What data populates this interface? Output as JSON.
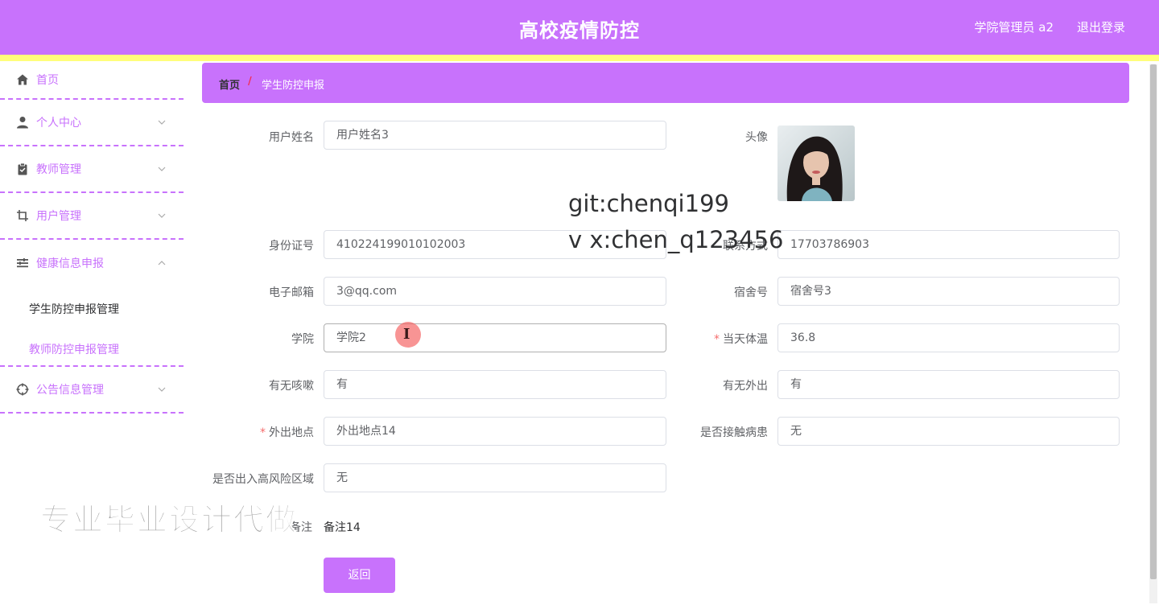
{
  "header": {
    "title": "高校疫情防控",
    "user": "学院管理员 a2",
    "logout": "退出登录"
  },
  "sidebar": {
    "items": [
      {
        "label": "首页",
        "icon": "home-icon"
      },
      {
        "label": "个人中心",
        "icon": "user-icon"
      },
      {
        "label": "教师管理",
        "icon": "clipboard-icon"
      },
      {
        "label": "用户管理",
        "icon": "crop-icon"
      },
      {
        "label": "健康信息申报",
        "icon": "list-icon"
      },
      {
        "label": "公告信息管理",
        "icon": "target-icon"
      }
    ],
    "submenu": [
      "学生防控申报管理",
      "教师防控申报管理"
    ]
  },
  "breadcrumb": {
    "home": "首页",
    "separator": "/",
    "current": "学生防控申报"
  },
  "form": {
    "username": {
      "label": "用户姓名",
      "value": "用户姓名3"
    },
    "avatar": {
      "label": "头像"
    },
    "idcard": {
      "label": "身份证号",
      "value": "410224199010102003"
    },
    "phone": {
      "label": "联系方式",
      "value": "17703786903"
    },
    "email": {
      "label": "电子邮箱",
      "value": "3@qq.com"
    },
    "dorm": {
      "label": "宿舍号",
      "value": "宿舍号3"
    },
    "college": {
      "label": "学院",
      "value": "学院2"
    },
    "temperature": {
      "label": "当天体温",
      "value": "36.8"
    },
    "cough": {
      "label": "有无咳嗽",
      "value": "有"
    },
    "goout": {
      "label": "有无外出",
      "value": "有"
    },
    "place": {
      "label": "外出地点",
      "value": "外出地点14"
    },
    "contact": {
      "label": "是否接触病患",
      "value": "无"
    },
    "risk": {
      "label": "是否出入高风险区域",
      "value": "无"
    },
    "remark": {
      "label": "备注",
      "value": "备注14"
    },
    "back": "返回"
  },
  "overlays": {
    "watermark_line1": "git:chenqi199",
    "watermark_line2": "v x:chen_q123456",
    "promo": "专业毕业设计代做",
    "cursor": "I"
  },
  "colors": {
    "accent": "#c872fc",
    "highlight": "#fffe7a",
    "required": "#f56c6c"
  }
}
